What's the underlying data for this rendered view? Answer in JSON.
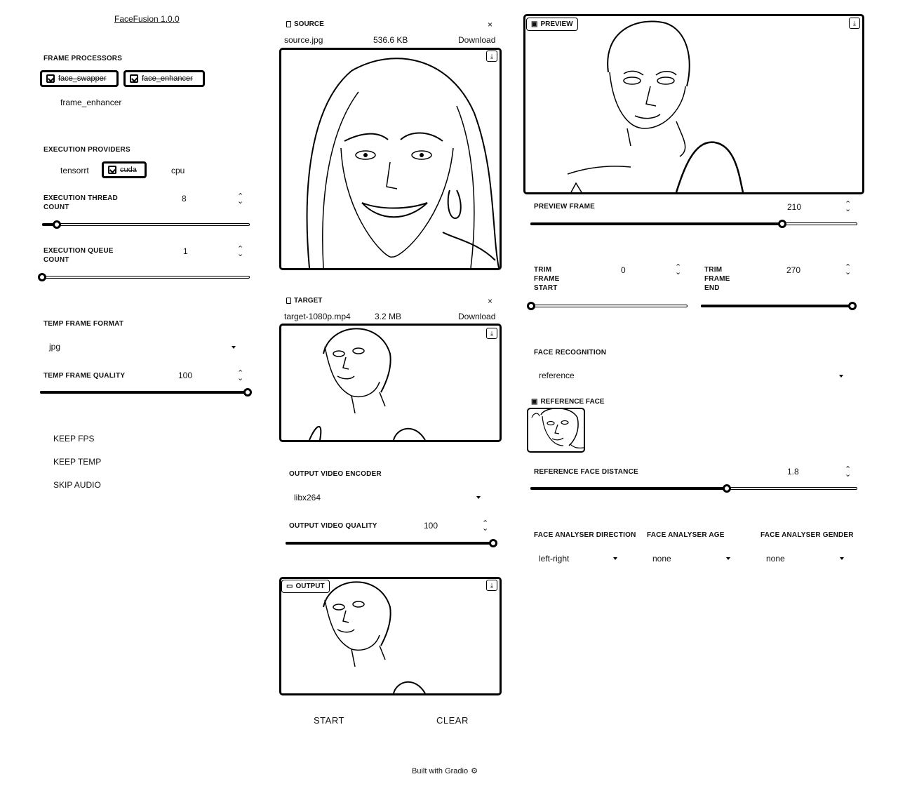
{
  "app": {
    "title": "FaceFusion 1.0.0",
    "footer": "Built with Gradio"
  },
  "frame_processors": {
    "label": "FRAME PROCESSORS",
    "items": [
      {
        "label": "face_swapper",
        "checked": true
      },
      {
        "label": "face_enhancer",
        "checked": true
      },
      {
        "label": "frame_enhancer",
        "checked": false
      }
    ]
  },
  "execution_providers": {
    "label": "EXECUTION PROVIDERS",
    "items": [
      {
        "label": "tensorrt",
        "checked": false
      },
      {
        "label": "cuda",
        "checked": true
      },
      {
        "label": "cpu",
        "checked": false
      }
    ]
  },
  "execution_thread_count": {
    "label_line1": "EXECUTION THREAD",
    "label_line2": "COUNT",
    "value": "8",
    "fraction": 0.07
  },
  "execution_queue_count": {
    "label_line1": "EXECUTION QUEUE",
    "label_line2": "COUNT",
    "value": "1",
    "fraction": 0.0
  },
  "temp_frame_format": {
    "label": "TEMP FRAME FORMAT",
    "value": "jpg"
  },
  "temp_frame_quality": {
    "label": "TEMP FRAME QUALITY",
    "value": "100",
    "fraction": 1.0
  },
  "options": {
    "keep_fps": "KEEP FPS",
    "keep_temp": "KEEP TEMP",
    "skip_audio": "SKIP AUDIO"
  },
  "source": {
    "tag": "SOURCE",
    "filename": "source.jpg",
    "size": "536.6 KB",
    "download": "Download",
    "close": "×"
  },
  "target": {
    "tag": "TARGET",
    "filename": "target-1080p.mp4",
    "size": "3.2 MB",
    "download": "Download",
    "close": "×"
  },
  "output_video_encoder": {
    "label": "OUTPUT VIDEO ENCODER",
    "value": "libx264"
  },
  "output_video_quality": {
    "label": "OUTPUT VIDEO QUALITY",
    "value": "100",
    "fraction": 1.0
  },
  "output": {
    "tag": "OUTPUT"
  },
  "actions": {
    "start": "START",
    "clear": "CLEAR"
  },
  "preview": {
    "tag": "PREVIEW"
  },
  "preview_frame": {
    "label": "PREVIEW FRAME",
    "value": "210",
    "fraction": 0.77
  },
  "trim_frame_start": {
    "line1": "TRIM",
    "line2": "FRAME",
    "line3": "START",
    "value": "0",
    "fraction": 0.0
  },
  "trim_frame_end": {
    "line1": "TRIM",
    "line2": "FRAME",
    "line3": "END",
    "value": "270",
    "fraction": 1.0
  },
  "face_recognition": {
    "label": "FACE RECOGNITION",
    "value": "reference"
  },
  "reference_face": {
    "tag": "REFERENCE FACE"
  },
  "reference_face_distance": {
    "label": "REFERENCE FACE DISTANCE",
    "value": "1.8",
    "fraction": 0.6
  },
  "face_analyser_direction": {
    "label": "FACE ANALYSER DIRECTION",
    "value": "left-right"
  },
  "face_analyser_age": {
    "label": "FACE ANALYSER AGE",
    "value": "none"
  },
  "face_analyser_gender": {
    "label": "FACE ANALYSER GENDER",
    "value": "none"
  },
  "icons": {
    "stepper": "up-down-arrows",
    "download": "download-icon",
    "close": "close-icon",
    "file": "file-icon",
    "image": "image-icon",
    "video": "video-icon"
  }
}
